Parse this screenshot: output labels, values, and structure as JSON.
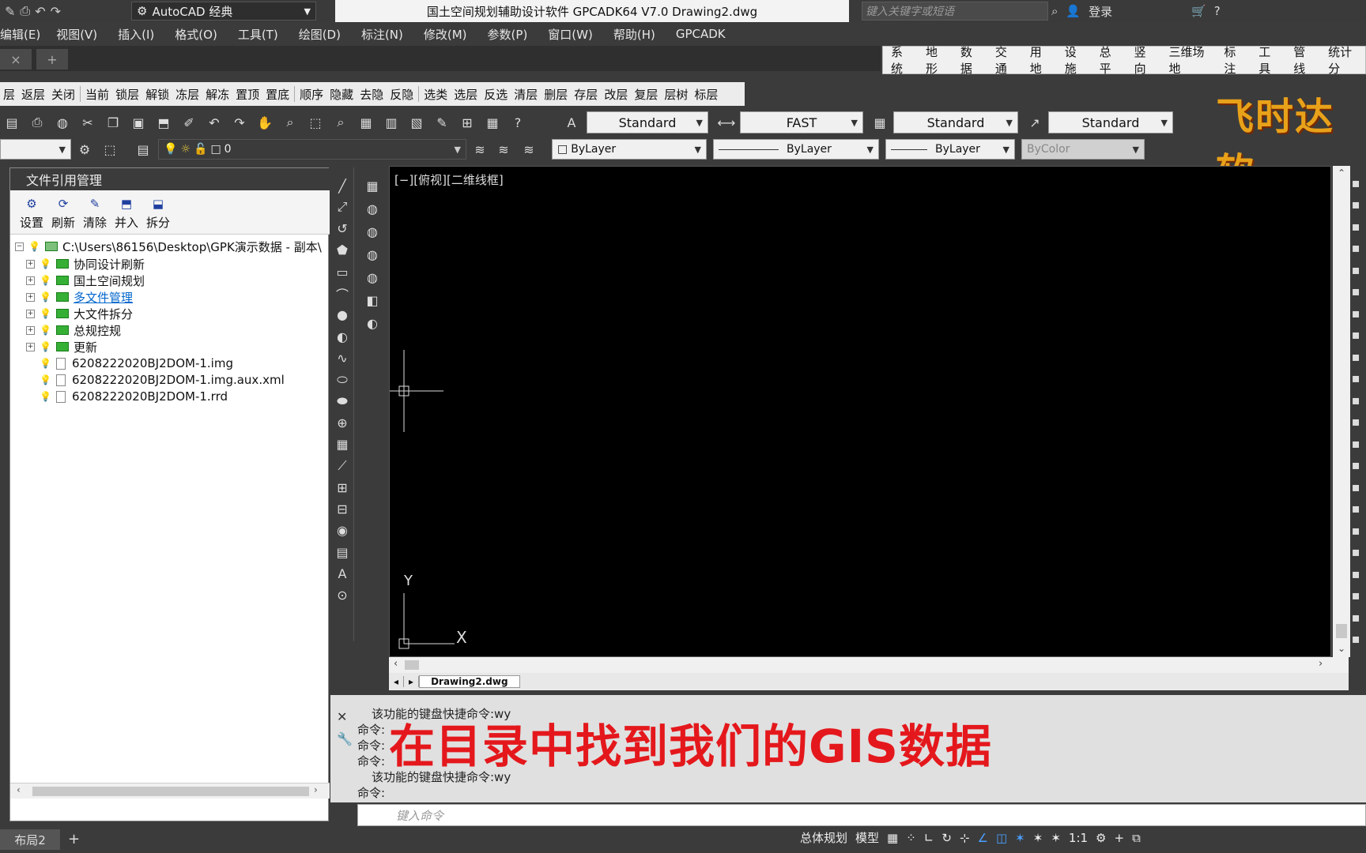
{
  "window": {
    "workspace": "AutoCAD 经典",
    "title": "国土空间规划辅助设计软件 GPCADK64 V7.0    Drawing2.dwg",
    "search_placeholder": "键入关键字或短语",
    "login": "登录"
  },
  "menu": [
    "编辑(E)",
    "视图(V)",
    "插入(I)",
    "格式(O)",
    "工具(T)",
    "绘图(D)",
    "标注(N)",
    "修改(M)",
    "参数(P)",
    "窗口(W)",
    "帮助(H)",
    "GPCADK"
  ],
  "gpk_menu": [
    "系统",
    "地形",
    "数据",
    "交通",
    "用地",
    "设施",
    "总平",
    "竖向",
    "三维场地",
    "标注",
    "工具",
    "管线",
    "统计分"
  ],
  "layer_tools": [
    "层",
    "返层",
    "关闭",
    "当前",
    "锁层",
    "解锁",
    "冻层",
    "解冻",
    "置顶",
    "置底",
    "顺序",
    "隐藏",
    "去隐",
    "反隐",
    "选类",
    "选层",
    "反选",
    "清层",
    "删层",
    "存层",
    "改层",
    "复层",
    "层树",
    "标层"
  ],
  "brand_text": "飞时达软",
  "styles": {
    "text_style": "Standard",
    "dim_style": "FAST",
    "table_style": "Standard",
    "mleader_style": "Standard"
  },
  "properties": {
    "layer": "0",
    "color": "ByLayer",
    "linetype": "ByLayer",
    "lineweight": "ByLayer",
    "plotstyle": "ByColor"
  },
  "file_panel": {
    "title": "文件引用管理",
    "tools": [
      "设置",
      "刷新",
      "清除",
      "并入",
      "拆分"
    ],
    "root": "C:\\Users\\86156\\Desktop\\GPK演示数据 - 副本\\",
    "folders": [
      "协同设计刷新",
      "国土空间规划",
      "多文件管理",
      "大文件拆分",
      "总规控规",
      "更新"
    ],
    "files": [
      "6208222020BJ2DOM-1.img",
      "6208222020BJ2DOM-1.img.aux.xml",
      "6208222020BJ2DOM-1.rrd"
    ]
  },
  "viewport": {
    "label": "[−][俯视][二维线框]",
    "axis_x": "X",
    "axis_y": "Y"
  },
  "doc_tab": "Drawing2.dwg",
  "command": {
    "history": [
      "该功能的键盘快捷命令:wy",
      "命令:",
      "命令:",
      "命令:",
      "该功能的键盘快捷命令:wy",
      "命令:"
    ],
    "placeholder": "键入命令"
  },
  "subtitle": "在目录中找到我们的GIS数据",
  "status": {
    "layout_tab": "布局2",
    "plan_label": "总体规划",
    "model_label": "模型",
    "scale": "1:1"
  },
  "colors": {
    "accent_red": "#e4181c",
    "brand_orange": "#e8a21a",
    "folder_green": "#35b035",
    "link_blue": "#0066cc"
  }
}
